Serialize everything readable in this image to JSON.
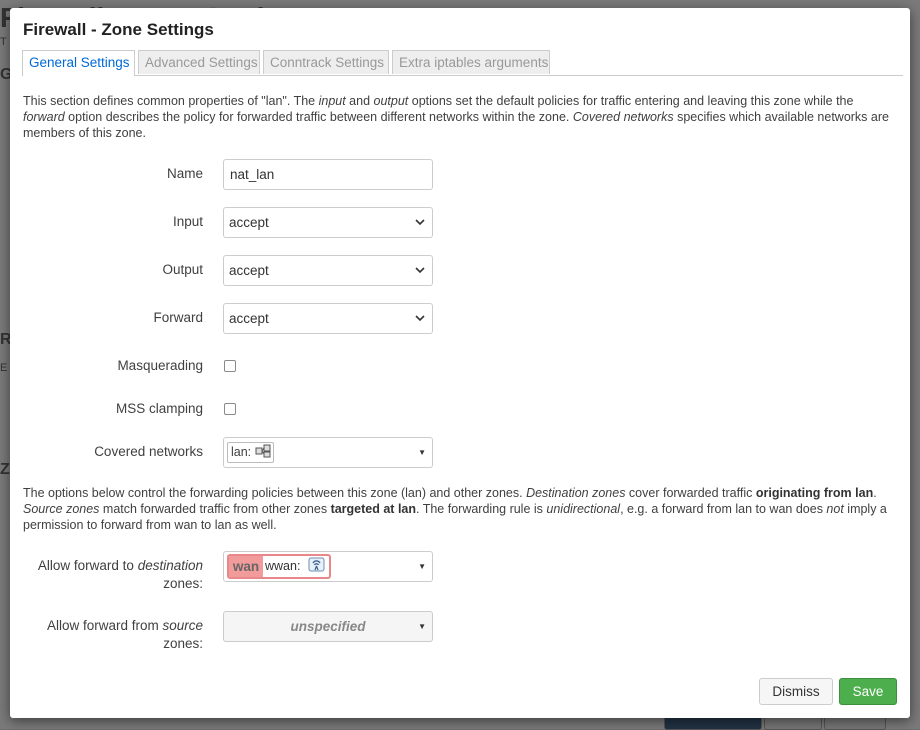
{
  "background": {
    "title_fragment": "Firewall - Zone Settings",
    "fragments": [
      "T",
      "G",
      "R",
      "E",
      "Z"
    ]
  },
  "modal": {
    "title": "Firewall - Zone Settings",
    "tabs": [
      {
        "label": "General Settings",
        "active": true
      },
      {
        "label": "Advanced Settings",
        "active": false
      },
      {
        "label": "Conntrack Settings",
        "active": false
      },
      {
        "label": "Extra iptables arguments",
        "active": false
      }
    ],
    "intro": {
      "p1": "This section defines common properties of \"lan\". The ",
      "i1": "input",
      "p2": " and ",
      "i2": "output",
      "p3": " options set the default policies for traffic entering and leaving this zone while the ",
      "i3": "forward",
      "p4": " option describes the policy for forwarded traffic between different networks within the zone. ",
      "i4": "Covered networks",
      "p5": " specifies which available networks are members of this zone."
    },
    "fields": {
      "name": {
        "label": "Name",
        "value": "nat_lan"
      },
      "input": {
        "label": "Input",
        "value": "accept"
      },
      "output": {
        "label": "Output",
        "value": "accept"
      },
      "forward": {
        "label": "Forward",
        "value": "accept"
      },
      "masquerading": {
        "label": "Masquerading",
        "checked": false
      },
      "mss_clamping": {
        "label": "MSS clamping",
        "checked": false
      },
      "covered_networks": {
        "label": "Covered networks",
        "value": "lan:"
      }
    },
    "forwarding_desc": {
      "p1": "The options below control the forwarding policies between this zone (lan) and other zones. ",
      "i1": "Destination zones",
      "p2": " cover forwarded traffic ",
      "b1": "originating from lan",
      "p3": ". ",
      "i2": "Source zones",
      "p4": " match forwarded traffic from other zones ",
      "b2": "targeted at lan",
      "p5": ". The forwarding rule is ",
      "i3": "unidirectional",
      "p6": ", e.g. a forward from lan to wan does ",
      "i4": "not",
      "p7": " imply a permission to forward from wan to lan as well."
    },
    "allow_forward_to": {
      "label_pre": "Allow forward to ",
      "label_em": "destination",
      "label_post": "zones:",
      "zone": "wan",
      "zone_network": "wwan:",
      "zone_color": "#f19b9b"
    },
    "allow_forward_from": {
      "label_pre": "Allow forward from ",
      "label_em": "source",
      "label_post": "zones:",
      "value": "unspecified"
    },
    "buttons": {
      "dismiss": "Dismiss",
      "save": "Save"
    },
    "colors": {
      "tab_active": "#0069d6",
      "save_bg": "#4cae4c"
    }
  }
}
